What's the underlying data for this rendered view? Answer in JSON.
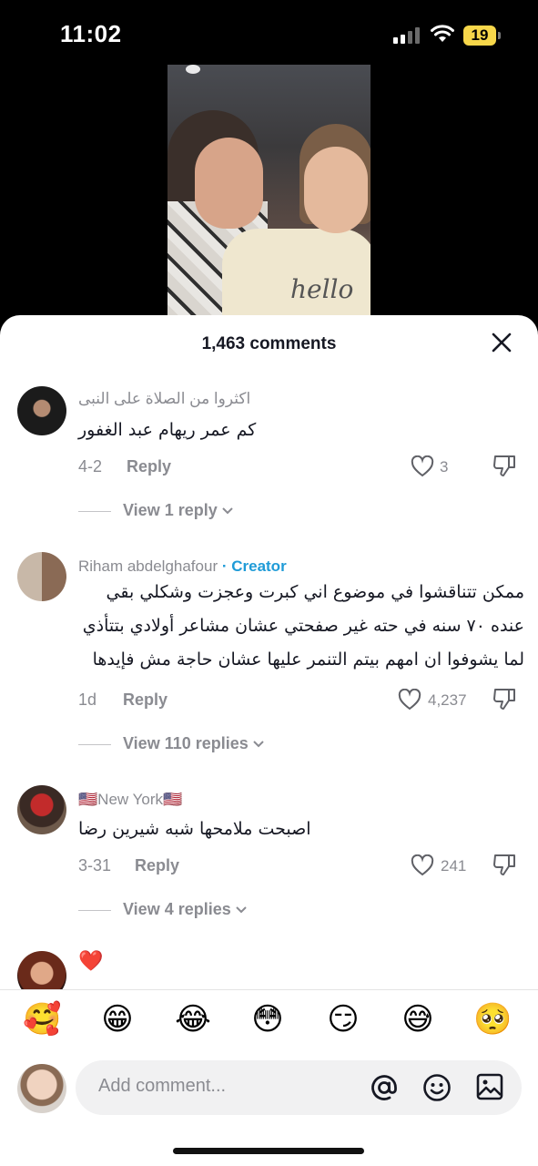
{
  "status_bar": {
    "time": "11:02",
    "battery": "19"
  },
  "video": {
    "sweater_text": "hello"
  },
  "sheet": {
    "title": "1,463 comments"
  },
  "comments": [
    {
      "username": "اكثروا من الصلاة على النبى",
      "text": "كم عمر ريهام عبد الغفور",
      "date": "4-2",
      "reply_label": "Reply",
      "likes": "3",
      "view_replies": "View 1 reply"
    },
    {
      "username": "Riham abdelghafour",
      "badge": " · Creator",
      "text": "ممكن تتناقشوا في موضوع اني كبرت وعجزت وشكلي بقي عنده ٧٠ سنه في حته غير صفحتي عشان مشاعر أولادي بتتأذي لما يشوفوا ان امهم بيتم التنمر عليها عشان حاجة مش فإيدها",
      "date": "1d",
      "reply_label": "Reply",
      "likes": "4,237",
      "view_replies": "View 110 replies"
    },
    {
      "username": "🇺🇸New York🇺🇸",
      "text": "اصبحت ملامحها شبه شيرين رضا",
      "date": "3-31",
      "reply_label": "Reply",
      "likes": "241",
      "view_replies": "View 4 replies"
    },
    {
      "username": "❤️"
    }
  ],
  "emojis": [
    "🥰",
    "😁",
    "😂",
    "😳",
    "😏",
    "😅",
    "🥺"
  ],
  "composer": {
    "placeholder": "Add comment..."
  },
  "colors": {
    "creator": "#1f9bd7",
    "heart": "#e0202c",
    "battery": "#f7d74a"
  }
}
